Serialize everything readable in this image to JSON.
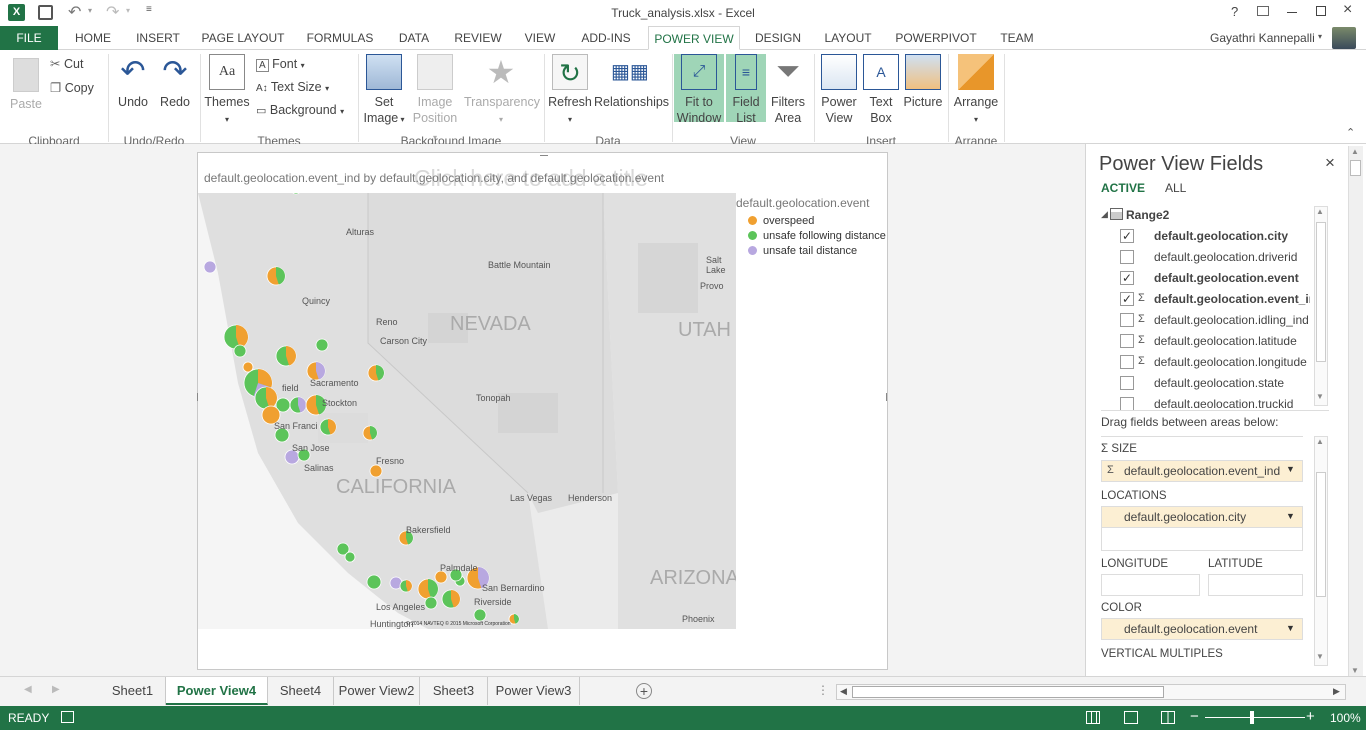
{
  "window": {
    "title": "Truck_analysis.xlsx - Excel",
    "help": "?",
    "user": "Gayathri Kannepalli"
  },
  "tabs": [
    "FILE",
    "HOME",
    "INSERT",
    "PAGE LAYOUT",
    "FORMULAS",
    "DATA",
    "REVIEW",
    "VIEW",
    "ADD-INS",
    "POWER VIEW",
    "DESIGN",
    "LAYOUT",
    "POWERPIVOT",
    "TEAM"
  ],
  "ribbon": {
    "paste": "Paste",
    "cut": "Cut",
    "copy": "Copy",
    "undo": "Undo",
    "redo": "Redo",
    "themes": "Themes",
    "font": "Font",
    "text_size": "Text Size",
    "background": "Background",
    "set_image": [
      "Set",
      "Image"
    ],
    "image_position": [
      "Image",
      "Position"
    ],
    "transparency": "Transparency",
    "refresh": "Refresh",
    "relationships": "Relationships",
    "fit_to_window": [
      "Fit to",
      "Window"
    ],
    "field_list": [
      "Field",
      "List"
    ],
    "filters_area": [
      "Filters",
      "Area"
    ],
    "power_view": [
      "Power",
      "View"
    ],
    "text_box": [
      "Text",
      "Box"
    ],
    "picture": "Picture",
    "arrange": "Arrange",
    "groups": [
      "Clipboard",
      "Undo/Redo",
      "Themes",
      "Background Image",
      "Data",
      "View",
      "Insert",
      "Arrange"
    ]
  },
  "report": {
    "title_placeholder": "Click here to add a title",
    "map_title": "default.geolocation.event_ind by default.geolocation.city, and default.geolocation.event",
    "legend_title": "default.geolocation.event",
    "legend": [
      {
        "label": "overspeed",
        "color": "#f0a030"
      },
      {
        "label": "unsafe following distance",
        "color": "#5cc45a"
      },
      {
        "label": "unsafe tail distance",
        "color": "#b8a8e0"
      }
    ],
    "map_labels": {
      "nevada": "NEVADA",
      "california": "CALIFORNIA",
      "arizona": "ARIZONA",
      "utah": "UTAH",
      "alturas": "Alturas",
      "battle_mountain": "Battle Mountain",
      "salt_lake": "Salt Lake",
      "provo": "Provo",
      "quincy": "Quincy",
      "reno": "Reno",
      "carson_city": "Carson City",
      "sacramento": "Sacramento",
      "stockton": "Stockton",
      "san_francisco": "San Franci",
      "san_jose": "San Jose",
      "salinas": "Salinas",
      "fresno": "Fresno",
      "tonopah": "Tonopah",
      "las_vegas": "Las Vegas",
      "henderson": "Henderson",
      "bakersfield": "Bakersfield",
      "palmdale": "Palmdale",
      "san_bernardino": "San Bernardino",
      "los_angeles": "Los Angeles",
      "riverside": "Riverside",
      "huntington": "Huntington",
      "phoenix": "Phoenix",
      "fairfield": "field",
      "copyright": "© 2014 NAVTEQ  © 2015 Microsoft Corporation"
    }
  },
  "fields_panel": {
    "title": "Power View Fields",
    "tab_active": "ACTIVE",
    "tab_all": "ALL",
    "table": "Range2",
    "fields": [
      {
        "name": "default.geolocation.city",
        "checked": true,
        "sigma": false
      },
      {
        "name": "default.geolocation.driverid",
        "checked": false,
        "sigma": false
      },
      {
        "name": "default.geolocation.event",
        "checked": true,
        "sigma": false
      },
      {
        "name": "default.geolocation.event_ind",
        "checked": true,
        "sigma": true
      },
      {
        "name": "default.geolocation.idling_ind",
        "checked": false,
        "sigma": true
      },
      {
        "name": "default.geolocation.latitude",
        "checked": false,
        "sigma": true
      },
      {
        "name": "default.geolocation.longitude",
        "checked": false,
        "sigma": true
      },
      {
        "name": "default.geolocation.state",
        "checked": false,
        "sigma": false
      },
      {
        "name": "default.geolocation.truckid",
        "checked": false,
        "sigma": false
      }
    ],
    "drag_hint": "Drag fields between areas below:",
    "size_label": "SIZE",
    "size_value": "default.geolocation.event_ind",
    "locations_label": "LOCATIONS",
    "locations_value": "default.geolocation.city",
    "longitude_label": "LONGITUDE",
    "latitude_label": "LATITUDE",
    "color_label": "COLOR",
    "color_value": "default.geolocation.event",
    "vertical_multiples_label": "VERTICAL MULTIPLES"
  },
  "sheets": [
    {
      "name": "Sheet1",
      "active": false
    },
    {
      "name": "Power View4",
      "active": true
    },
    {
      "name": "Sheet4",
      "active": false
    },
    {
      "name": "Power View2",
      "active": false
    },
    {
      "name": "Sheet3",
      "active": false
    },
    {
      "name": "Power View3",
      "active": false
    }
  ],
  "status": {
    "ready": "READY",
    "zoom": "100%"
  },
  "colors": {
    "excel_green": "#217346",
    "overspeed": "#f0a030",
    "following": "#5cc45a",
    "tail": "#b8a8e0"
  }
}
